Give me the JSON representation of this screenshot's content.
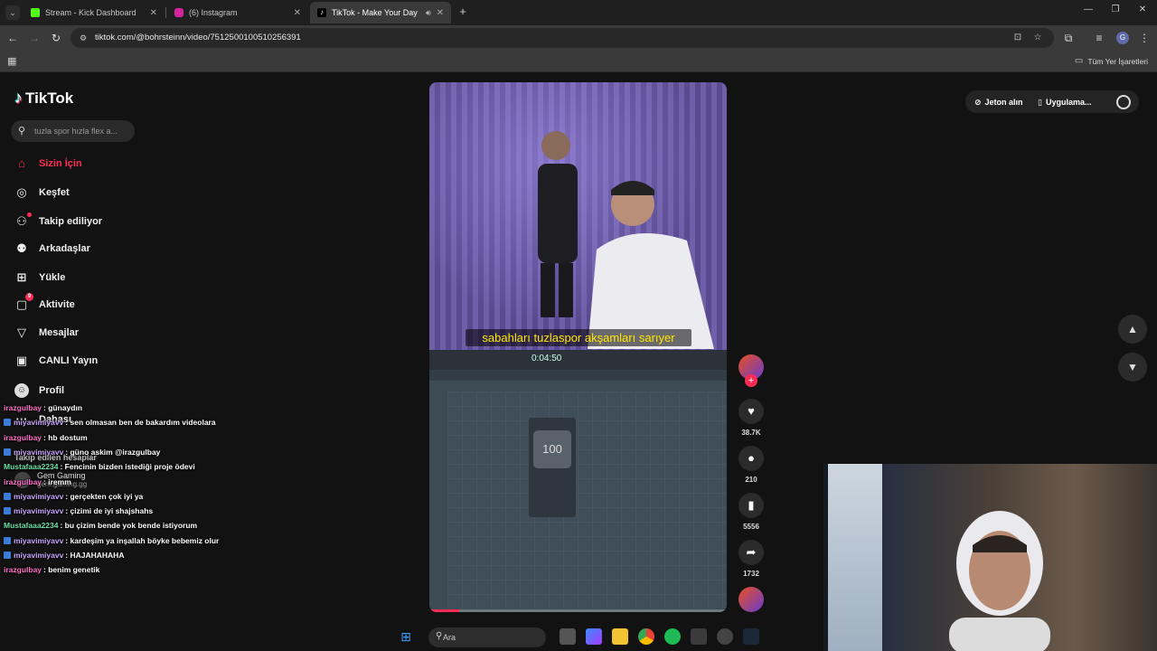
{
  "browser": {
    "tabs": [
      {
        "title": "Stream - Kick Dashboard",
        "favicon_color": "#53fc18",
        "active": false
      },
      {
        "title": "(6) Instagram",
        "favicon_color": "#d6249f",
        "active": false
      },
      {
        "title": "TikTok - Make Your Day",
        "favicon_color": "#111111",
        "active": true
      }
    ],
    "url": "tiktok.com/@bohrsteinn/video/7512500100510256391",
    "bookmarks_all": "Tüm Yer İşaretleri",
    "profile_letter": "G"
  },
  "tiktok": {
    "logo": "TikTok",
    "search_placeholder": "tuzla spor hızla flex a...",
    "nav": [
      {
        "label": "Sizin İçin",
        "icon": "home-icon",
        "active": true
      },
      {
        "label": "Keşfet",
        "icon": "compass-icon"
      },
      {
        "label": "Takip ediliyor",
        "icon": "following-icon"
      },
      {
        "label": "Arkadaşlar",
        "icon": "friends-icon"
      },
      {
        "label": "Yükle",
        "icon": "upload-icon"
      },
      {
        "label": "Aktivite",
        "icon": "activity-icon",
        "badge": "9"
      },
      {
        "label": "Mesajlar",
        "icon": "inbox-icon"
      },
      {
        "label": "CANLI Yayın",
        "icon": "live-icon"
      },
      {
        "label": "Profil",
        "icon": "profile-icon"
      },
      {
        "label": "Dahası",
        "icon": "more-icon"
      }
    ],
    "followed_heading": "Takip edilen hesaplar",
    "followed_account": {
      "name": "Gem Gaming",
      "handle": "gem.gaming.gg"
    },
    "top_actions": {
      "coins": "Jeton alın",
      "app": "Uygulama..."
    },
    "video": {
      "subtitle": "sabahları tuzlaspor akşamları sarıyer",
      "daw_time": "0:04:50",
      "tempo_value": "100",
      "progress": 0.1
    },
    "stats": {
      "likes": "38.7K",
      "comments": "210",
      "saves": "5556",
      "shares": "1732"
    }
  },
  "chat": [
    {
      "user": "irazgulbay",
      "msg": ": günaydın",
      "color": "#ff6ec7",
      "kick": false
    },
    {
      "user": "miyavimiyavv",
      "msg": ": sen olmasan ben de bakardım videolara",
      "color": "#c9a7ff",
      "kick": true
    },
    {
      "user": "irazgulbay",
      "msg": ": hb dostum",
      "color": "#ff6ec7",
      "kick": false
    },
    {
      "user": "miyavimiyavv",
      "msg": ": güno askim @irazgulbay",
      "color": "#c9a7ff",
      "kick": true
    },
    {
      "user": "Mustafaaa2234",
      "msg": ": Fencinin bizden istediği proje ödevi",
      "color": "#6fe0a6",
      "kick": false
    },
    {
      "user": "irazgulbay",
      "msg": ": iremm",
      "color": "#ff6ec7",
      "kick": false
    },
    {
      "user": "miyavimiyavv",
      "msg": ": gerçekten çok iyi ya",
      "color": "#c9a7ff",
      "kick": true
    },
    {
      "user": "miyavimiyavv",
      "msg": ": çizimi de iyi shajshahs",
      "color": "#c9a7ff",
      "kick": true
    },
    {
      "user": "Mustafaaa2234",
      "msg": ": bu çizim bende yok bende istiyorum",
      "color": "#6fe0a6",
      "kick": false
    },
    {
      "user": "miyavimiyavv",
      "msg": ": kardeşim ya inşallah böyke bebemiz olur",
      "color": "#c9a7ff",
      "kick": true
    },
    {
      "user": "miyavimiyavv",
      "msg": ": HAJAHAHAHA",
      "color": "#c9a7ff",
      "kick": true
    },
    {
      "user": "irazgulbay",
      "msg": ": benim genetik",
      "color": "#ff6ec7",
      "kick": false
    }
  ],
  "taskbar": {
    "search": "Ara"
  },
  "colors": {
    "accent": "#fe2c55",
    "bg": "#121212"
  }
}
